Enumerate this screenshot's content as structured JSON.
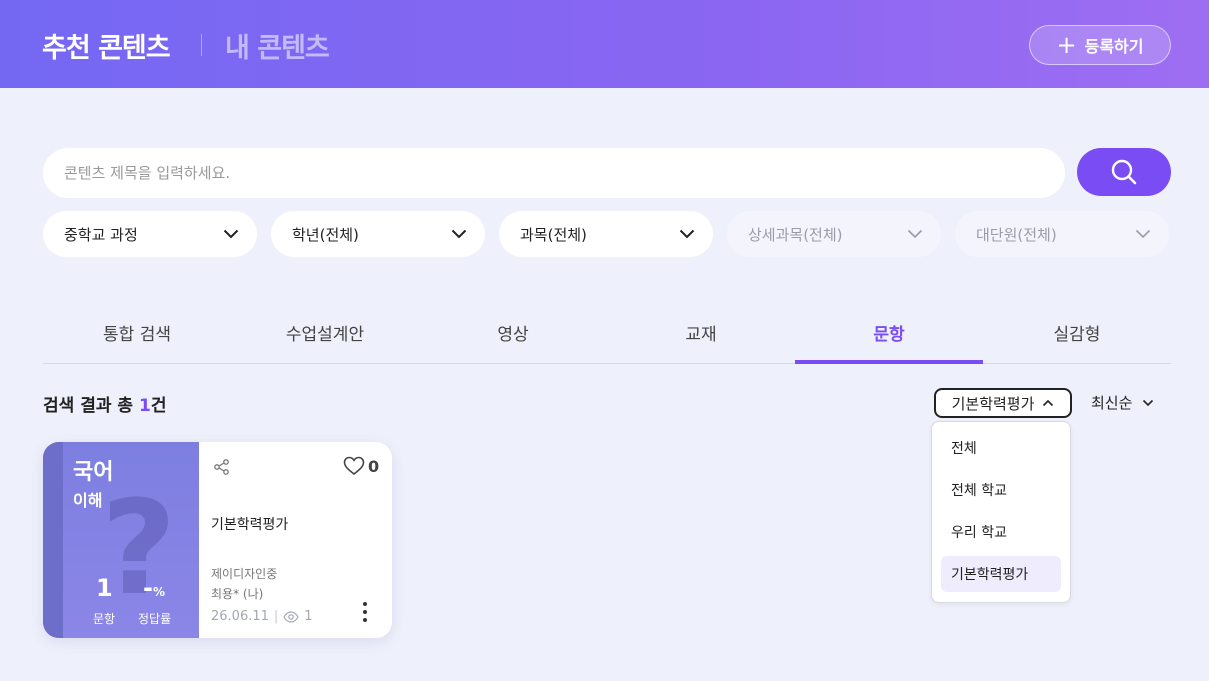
{
  "header": {
    "tab_recommended": "추천 콘텐츠",
    "tab_mine": "내 콘텐츠",
    "register_button": "등록하기"
  },
  "search": {
    "placeholder": "콘텐츠 제목을 입력하세요."
  },
  "filters": [
    {
      "label": "중학교 과정",
      "enabled": true
    },
    {
      "label": "학년(전체)",
      "enabled": true
    },
    {
      "label": "과목(전체)",
      "enabled": true
    },
    {
      "label": "상세과목(전체)",
      "enabled": false
    },
    {
      "label": "대단원(전체)",
      "enabled": false
    }
  ],
  "tabs": [
    {
      "label": "통합 검색",
      "active": false
    },
    {
      "label": "수업설계안",
      "active": false
    },
    {
      "label": "영상",
      "active": false
    },
    {
      "label": "교재",
      "active": false
    },
    {
      "label": "문항",
      "active": true
    },
    {
      "label": "실감형",
      "active": false
    }
  ],
  "results": {
    "prefix": "검색 결과 총 ",
    "count": "1",
    "suffix": "건"
  },
  "category_dropdown": {
    "selected": "기본학력평가",
    "options": [
      "전체",
      "전체 학교",
      "우리 학교",
      "기본학력평가"
    ]
  },
  "sort": {
    "selected": "최신순"
  },
  "card": {
    "subject": "국어",
    "sub_subject": "이해",
    "question_count": "1",
    "question_label": "문항",
    "accuracy": "-",
    "accuracy_unit": "%",
    "accuracy_label": "정답률",
    "likes": "0",
    "title": "기본학력평가",
    "author": "제이디자인중",
    "usage": "최용* (나)",
    "date": "26.06.11",
    "views": "1"
  },
  "colors": {
    "accent": "#7a4cf3",
    "header_gradient_start": "#7468f3",
    "header_gradient_end": "#9e6ef2",
    "card_thumb": "#8183e3"
  }
}
